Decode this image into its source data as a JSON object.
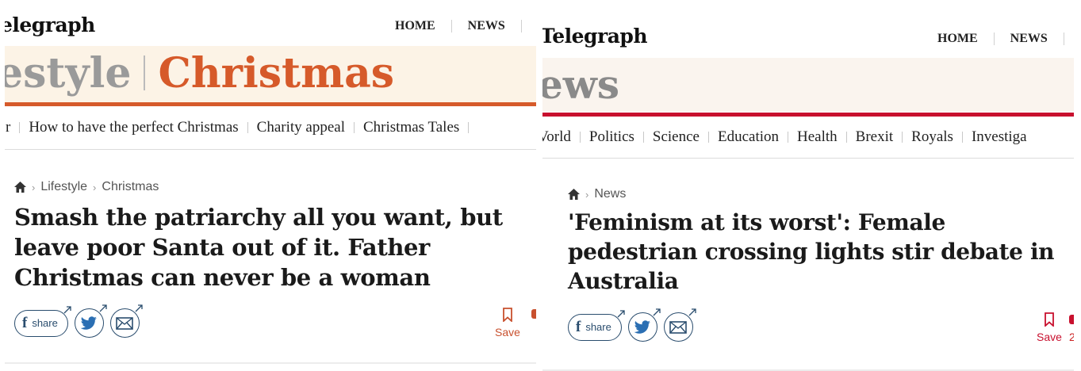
{
  "left_article": {
    "logo": "elegraph",
    "nav": [
      "HOME",
      "NEWS"
    ],
    "section": {
      "prefix": "estyle",
      "name": "Christmas"
    },
    "subnav": [
      "r",
      "How to have the perfect Christmas",
      "Charity appeal",
      "Christmas Tales"
    ],
    "breadcrumb": [
      "Lifestyle",
      "Christmas"
    ],
    "headline_lines": [
      "Smash the patriarchy all you want, but",
      "leave poor Santa out of it. Father",
      "Christmas can never be a woman"
    ],
    "share_label": "share",
    "save_label": "Save",
    "colors": {
      "section_prefix": "#9a9a9a",
      "section_name": "#d65a2a",
      "band_rule": "#d65a2a"
    }
  },
  "right_article": {
    "logo": "Telegraph",
    "nav": [
      "HOME",
      "NEWS"
    ],
    "section": {
      "name": "ews"
    },
    "subnav": [
      "Vorld",
      "Politics",
      "Science",
      "Education",
      "Health",
      "Brexit",
      "Royals",
      "Investiga"
    ],
    "breadcrumb": [
      "News"
    ],
    "headline_lines": [
      "'Feminism at its worst': Female",
      "pedestrian crossing lights stir debate in",
      "Australia"
    ],
    "share_label": "share",
    "save_label": "Save",
    "edge_count": "2",
    "colors": {
      "section_name": "#8a8a8a",
      "band_rule": "#c8102e"
    }
  },
  "icons": [
    "home-icon",
    "facebook-icon",
    "twitter-icon",
    "email-icon",
    "bookmark-icon",
    "external-arrow-icon"
  ]
}
